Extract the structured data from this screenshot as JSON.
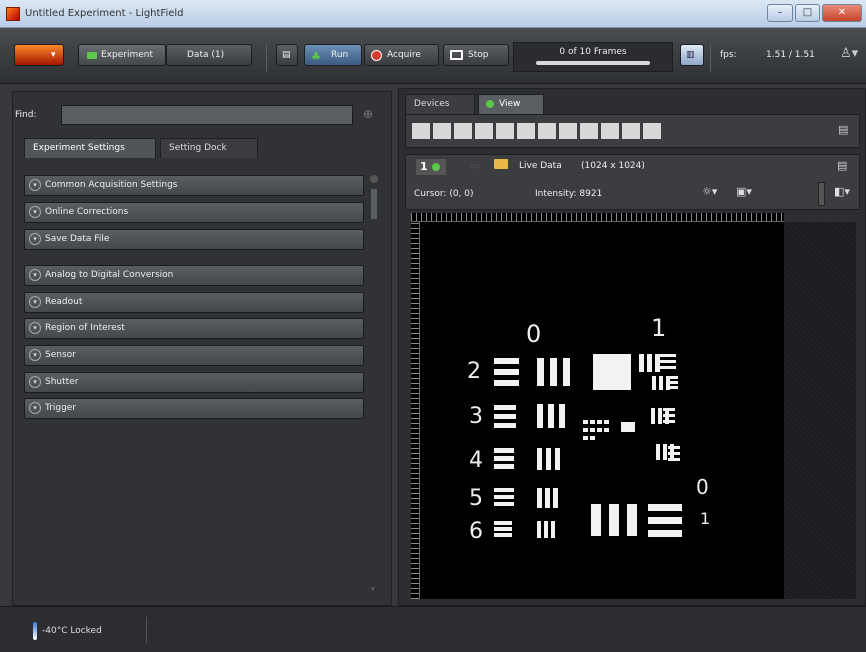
{
  "window": {
    "title": "Untitled Experiment - LightField"
  },
  "toolbar": {
    "experiment_label": "Experiment",
    "data_label": "Data (1)",
    "run_label": "Run",
    "acquire_label": "Acquire",
    "stop_label": "Stop",
    "frames_label": "0 of 10 Frames",
    "fps_label": "fps:",
    "fps_value": "1.51 / 1.51"
  },
  "left": {
    "find_label": "Find:",
    "find_value": "",
    "tabs": [
      "Experiment Settings",
      "Setting Dock"
    ],
    "sections_top": [
      "Common Acquisition Settings",
      "Online Corrections",
      "Save Data File"
    ],
    "sections_bottom": [
      "Analog to Digital Conversion",
      "Readout",
      "Region of Interest",
      "Sensor",
      "Shutter",
      "Trigger"
    ]
  },
  "right": {
    "tabs": [
      "Devices",
      "View"
    ],
    "view_number": "1",
    "live_label": "Live Data",
    "dims": "(1024 x 1024)",
    "cursor": "Cursor: (0, 0)",
    "intensity": "Intensity: 8921"
  },
  "target": {
    "group_labels": [
      "0",
      "1"
    ],
    "element_labels": [
      "2",
      "3",
      "4",
      "5",
      "6"
    ],
    "small_group_labels": [
      "0",
      "1"
    ]
  },
  "status": {
    "temperature": "-40°C Locked"
  },
  "colors": {
    "accent": "#5cc84a",
    "frame_bar": "#d8d8d8"
  }
}
